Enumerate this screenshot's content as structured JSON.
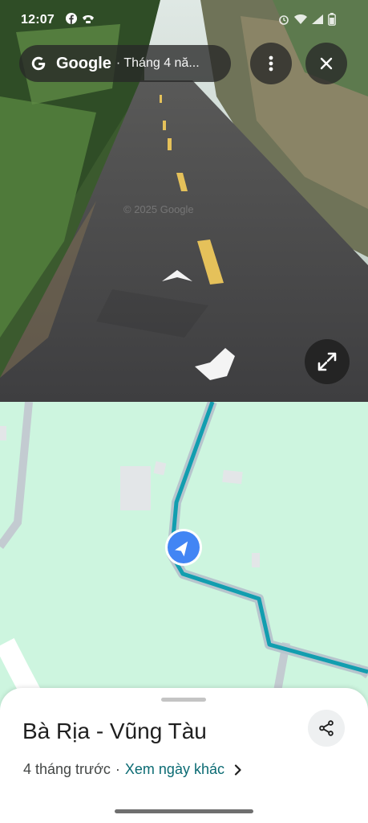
{
  "status_bar": {
    "time": "12:07",
    "left_icons": [
      "facebook-icon",
      "call-icon"
    ],
    "right_icons": [
      "alarm-icon",
      "wifi-icon",
      "signal-icon",
      "battery-icon"
    ]
  },
  "street_view": {
    "provider": "Google",
    "capture_date": "Tháng 4 nă...",
    "watermark": "© 2025 Google",
    "buttons": [
      "more-options",
      "close",
      "expand"
    ]
  },
  "map": {
    "colors": {
      "land": "#cdf5df",
      "route": "#129eaf",
      "road": "#c0c8cf",
      "building": "#e3e6e8",
      "location": "#4285f4"
    }
  },
  "place": {
    "title": "Bà Rịa - Vũng Tàu",
    "age": "4 tháng trước",
    "other_dates_link": "Xem ngày khác"
  }
}
